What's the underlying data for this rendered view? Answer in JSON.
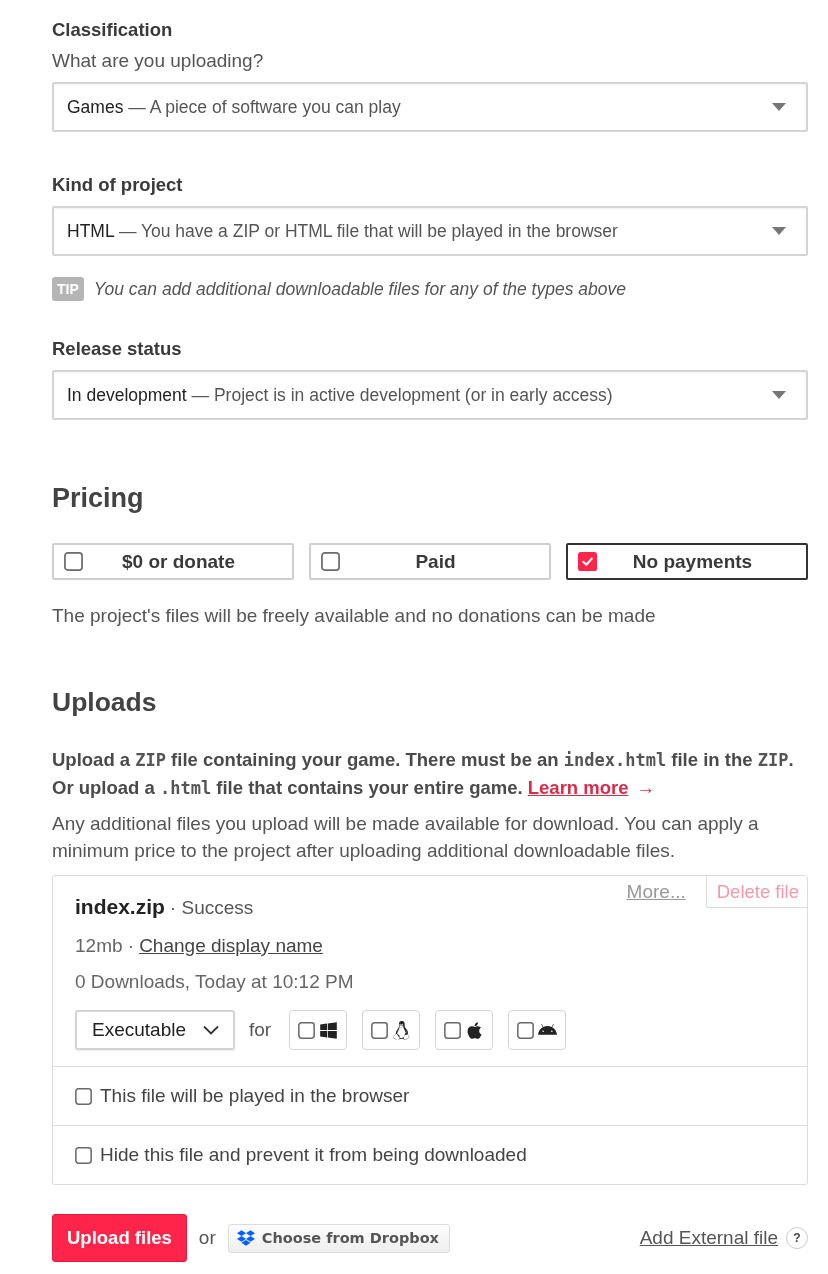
{
  "fields": [
    {
      "label": "Classification",
      "hint": "What are you uploading?",
      "value": "Games",
      "description": "— A piece of software you can play"
    },
    {
      "label": "Kind of project",
      "value": "HTML",
      "description": "— You have a ZIP or HTML file that will be played in the browser",
      "tip": {
        "badge": "TIP",
        "text": "You can add additional downloadable files for any of the types above"
      }
    },
    {
      "label": "Release status",
      "value": "In development",
      "description": "— Project is in active development (or in early access)"
    }
  ],
  "pricing": {
    "heading": "Pricing",
    "options": [
      {
        "label": "$0 or donate",
        "selected": false
      },
      {
        "label": "Paid",
        "selected": false
      },
      {
        "label": "No payments",
        "selected": true
      }
    ],
    "note": "The project's files will be freely available and no donations can be made"
  },
  "uploads": {
    "heading": "Uploads",
    "instructions": [
      [
        {
          "kind": "text",
          "text": "Upload a "
        },
        {
          "kind": "code",
          "text": "ZIP"
        },
        {
          "kind": "text",
          "text": " file containing your game. There must be an "
        },
        {
          "kind": "code",
          "text": "index.html"
        },
        {
          "kind": "text",
          "text": " file in the "
        },
        {
          "kind": "code",
          "text": "ZIP"
        },
        {
          "kind": "text",
          "text": "."
        }
      ],
      [
        {
          "kind": "text",
          "text": "Or upload a "
        },
        {
          "kind": "code",
          "text": ".html"
        },
        {
          "kind": "text",
          "text": " file that contains your entire game. "
        },
        {
          "kind": "link",
          "text": "Learn more",
          "arrow": "→"
        }
      ]
    ],
    "note": "Any additional files you upload will be made available for download. You can apply a minimum price to the project after uploading additional downloadable files.",
    "file": {
      "name": "index.zip",
      "status": "· Success",
      "more_link": "More...",
      "delete_button": "Delete file",
      "size": "12mb ·",
      "rename_link": "Change display name",
      "stats": "0 Downloads, Today at 10:12 PM",
      "type": "Executable",
      "for_label": "for",
      "platforms": [
        {
          "kind": "windows",
          "checked": false
        },
        {
          "kind": "linux",
          "checked": false
        },
        {
          "kind": "mac",
          "checked": false
        },
        {
          "kind": "android",
          "checked": false
        }
      ],
      "options": [
        {
          "label": "This file will be played in the browser",
          "checked": false
        },
        {
          "label": "Hide this file and prevent it from being downloaded",
          "checked": false
        }
      ]
    },
    "upload_button": "Upload files",
    "or": "or",
    "dropbox_button": "Choose from Dropbox",
    "external_link": "Add External file",
    "help": "?"
  }
}
